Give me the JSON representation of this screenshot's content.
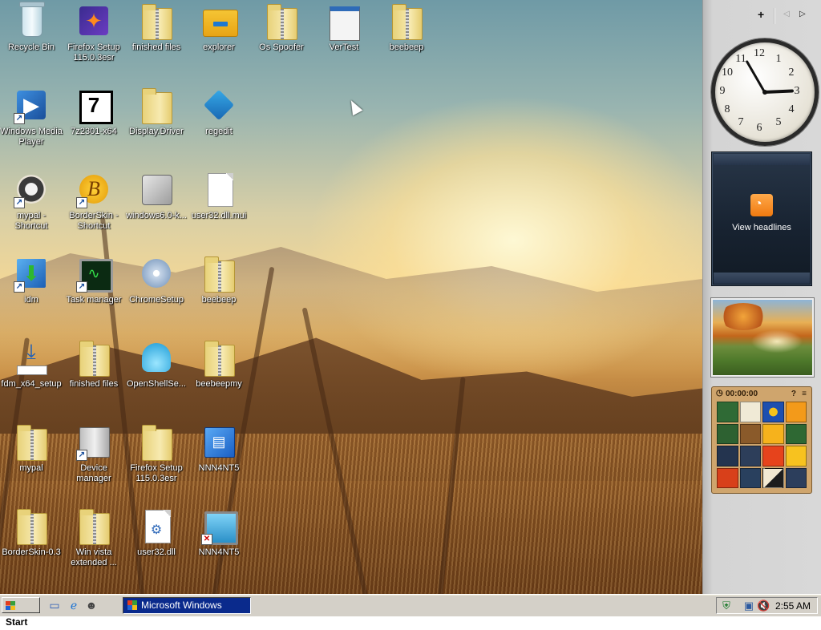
{
  "desktop": {
    "icons": [
      {
        "label": "Recycle Bin",
        "icon": "recycle-bin-icon"
      },
      {
        "label": "Firefox Setup 115.0.3esr",
        "icon": "firefox-installer-icon"
      },
      {
        "label": "finished files",
        "icon": "zip-folder-icon"
      },
      {
        "label": "explorer",
        "icon": "explorer-folder-icon"
      },
      {
        "label": "Os Spoofer",
        "icon": "zip-folder-icon"
      },
      {
        "label": "VerTest",
        "icon": "window-app-icon"
      },
      {
        "label": "beebeep",
        "icon": "zip-folder-icon"
      },
      {
        "label": "Windows Media Player",
        "icon": "media-player-icon"
      },
      {
        "label": "7z2301-x64",
        "icon": "7zip-installer-icon"
      },
      {
        "label": "Display.Driver",
        "icon": "folder-icon"
      },
      {
        "label": "regedit",
        "icon": "registry-editor-icon"
      },
      {
        "label": "mypal - Shortcut",
        "icon": "mypal-browser-icon"
      },
      {
        "label": "BorderSkin - Shortcut",
        "icon": "borderskin-icon"
      },
      {
        "label": "windows6.0-k...",
        "icon": "update-package-icon"
      },
      {
        "label": "user32.dll.mui",
        "icon": "blank-file-icon"
      },
      {
        "label": "idm",
        "icon": "download-manager-icon"
      },
      {
        "label": "Task manager",
        "icon": "task-manager-icon"
      },
      {
        "label": "ChromeSetup",
        "icon": "setup-disc-icon"
      },
      {
        "label": "beebeep",
        "icon": "zip-folder-icon"
      },
      {
        "label": "fdm_x64_setup",
        "icon": "download-setup-icon"
      },
      {
        "label": "finished files",
        "icon": "zip-folder-icon"
      },
      {
        "label": "OpenShellSe...",
        "icon": "openshell-icon"
      },
      {
        "label": "beebeepmy",
        "icon": "zip-folder-icon"
      },
      {
        "label": "mypal",
        "icon": "zip-folder-icon"
      },
      {
        "label": "Device manager",
        "icon": "device-manager-icon"
      },
      {
        "label": "Firefox Setup 115.0.3esr",
        "icon": "folder-icon"
      },
      {
        "label": "NNN4NT5",
        "icon": "file-cabinet-icon"
      },
      {
        "label": "BorderSkin-0.3",
        "icon": "zip-folder-icon"
      },
      {
        "label": "Win vista extended ...",
        "icon": "zip-folder-icon"
      },
      {
        "label": "user32.dll",
        "icon": "dll-file-icon"
      },
      {
        "label": "NNN4NT5",
        "icon": "network-setup-icon"
      }
    ]
  },
  "sidebar": {
    "add_gadget": "+",
    "prev": "◁",
    "next": "▷",
    "clock": {
      "numbers": [
        "12",
        "1",
        "2",
        "3",
        "4",
        "5",
        "6",
        "7",
        "8",
        "9",
        "10",
        "11"
      ],
      "time": "2:55"
    },
    "feed": {
      "label": "View headlines",
      "icon": "rss-icon"
    },
    "slideshow": {
      "icon": "autumn-tree-photo"
    },
    "puzzle": {
      "timer": "00:00:00",
      "help": "?",
      "menu": "≡"
    }
  },
  "taskbar": {
    "start_label": "Start",
    "quicklaunch": [
      "show-desktop-icon",
      "internet-explorer-icon",
      "mypal-icon"
    ],
    "task_label": "Microsoft Windows",
    "tray_time": "2:55 AM",
    "tray_icons": [
      "windows-security-icon",
      "network-disconnected-icon",
      "volume-muted-icon"
    ]
  },
  "colors": {
    "task_active": "#0a2a8c",
    "taskbar": "#d4d0c8",
    "sidebar": "#d6d6d6"
  }
}
